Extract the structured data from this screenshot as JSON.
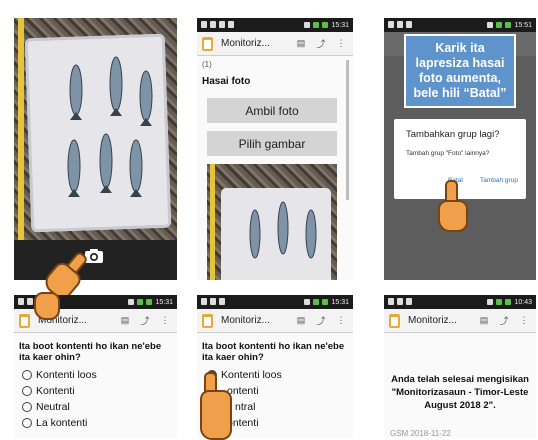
{
  "panel1": {
    "icon": "camera-icon"
  },
  "panel2": {
    "status_time": "15:31",
    "title": "Monitoriz...",
    "number": "(1)",
    "heading": "Hasai foto",
    "btn_take": "Ambil foto",
    "btn_pick": "Pilih gambar"
  },
  "panel3": {
    "status_time": "15:51",
    "annotation": "Karik ita lapresiza hasai foto aumenta, bele hili “Batal”",
    "dialog_title": "Tambahkan grup lagi?",
    "dialog_body": "Tambah grup \"Foto\" lainnya?",
    "btn_cancel": "Batal",
    "btn_add": "Tambah grup"
  },
  "panel4": {
    "status_time": "15:31",
    "title": "Monitoriz...",
    "question": "Ita boot kontenti ho ikan ne'ebe ita kaer ohin?",
    "options": [
      "Kontenti loos",
      "Kontenti",
      "Neutral",
      "La kontenti"
    ]
  },
  "panel5": {
    "status_time": "15:31",
    "title": "Monitoriz...",
    "question": "Ita boot kontenti ho ikan ne'ebe ita kaer ohin?",
    "options": [
      "Kontenti loos",
      "ontenti",
      "ntral",
      "ontenti"
    ]
  },
  "panel6": {
    "status_time": "10:43",
    "title": "Monitoriz...",
    "message": "Anda telah selesai mengisikan \"Monitorizasaun - Timor-Leste August 2018 2\".",
    "footer": "GSM 2018-11-22"
  },
  "colors": {
    "annotation_bg": "#5f93cc",
    "hand": "#f0a04a",
    "clip": "#e9a93a",
    "link": "#2a6fce"
  }
}
